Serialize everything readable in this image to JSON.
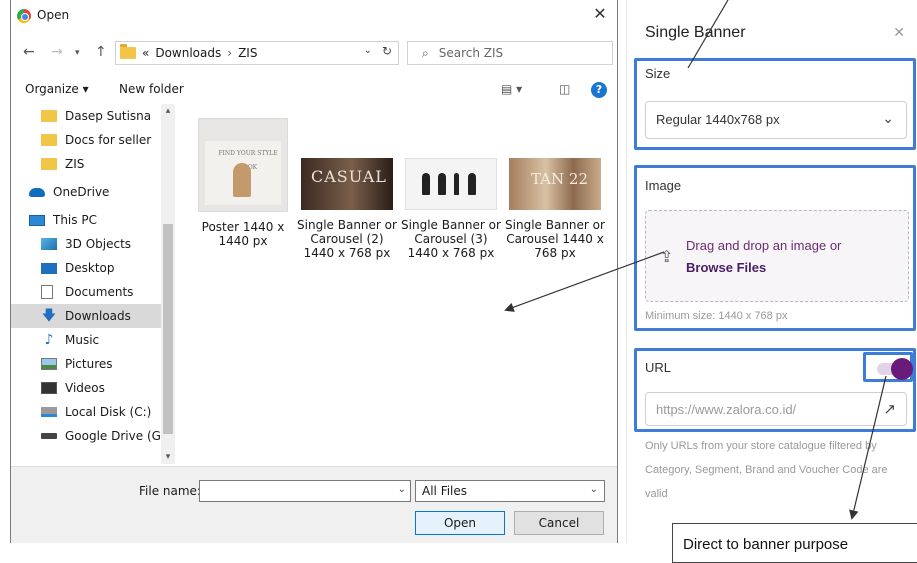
{
  "dialog": {
    "title": "Open",
    "breadcrumb": [
      "Downloads",
      "ZIS"
    ],
    "breadcrumb_prefix": "«",
    "search_placeholder": "Search ZIS",
    "toolbar": {
      "organize": "Organize ▾",
      "new_folder": "New folder"
    },
    "sidebar": [
      {
        "label": "Dasep Sutisna",
        "icon": "folder-icon"
      },
      {
        "label": "Docs for seller",
        "icon": "folder-icon"
      },
      {
        "label": "ZIS",
        "icon": "folder-icon"
      },
      {
        "label": "OneDrive",
        "icon": "cloud-icon"
      },
      {
        "label": "This PC",
        "icon": "computer-icon"
      },
      {
        "label": "3D Objects",
        "icon": "cube-icon"
      },
      {
        "label": "Desktop",
        "icon": "desktop-icon"
      },
      {
        "label": "Documents",
        "icon": "document-icon"
      },
      {
        "label": "Downloads",
        "icon": "download-icon",
        "selected": true
      },
      {
        "label": "Music",
        "icon": "music-icon"
      },
      {
        "label": "Pictures",
        "icon": "picture-icon"
      },
      {
        "label": "Videos",
        "icon": "video-icon"
      },
      {
        "label": "Local Disk (C:)",
        "icon": "disk-icon"
      },
      {
        "label": "Google Drive (G:)",
        "icon": "drive-icon"
      }
    ],
    "files": [
      {
        "name": "Poster 1440 x 1440 px"
      },
      {
        "name": "Single Banner or Carousel (2) 1440 x 768 px",
        "thumb_text": "CASUAL"
      },
      {
        "name": "Single Banner or Carousel (3) 1440 x 768 px"
      },
      {
        "name": "Single Banner or Carousel 1440 x 768 px",
        "thumb_text": "TAN 22"
      }
    ],
    "poster_thumb_text": "FIND YOUR STYLE LOOK",
    "file_name_label": "File name:",
    "file_name_value": "",
    "file_type": "All Files",
    "open_label": "Open",
    "cancel_label": "Cancel"
  },
  "panel": {
    "title": "Single Banner",
    "size_label": "Size",
    "size_value": "Regular 1440x768 px",
    "image_label": "Image",
    "drop_text": "Drag and drop an image or",
    "browse_text": "Browse Files",
    "min_size": "Minimum size: 1440 x 768 px",
    "url_label": "URL",
    "url_placeholder": "https://www.zalora.co.id/",
    "url_toggle_on": true,
    "help_text": "Only URLs from your store catalogue filtered by Category, Segment, Brand and Voucher Code are valid"
  },
  "tooltip": {
    "text": "Direct to banner purpose"
  },
  "colors": {
    "highlight": "#3d7dd8",
    "accent": "#6a1b7a",
    "windows_blue": "#0078d7"
  }
}
